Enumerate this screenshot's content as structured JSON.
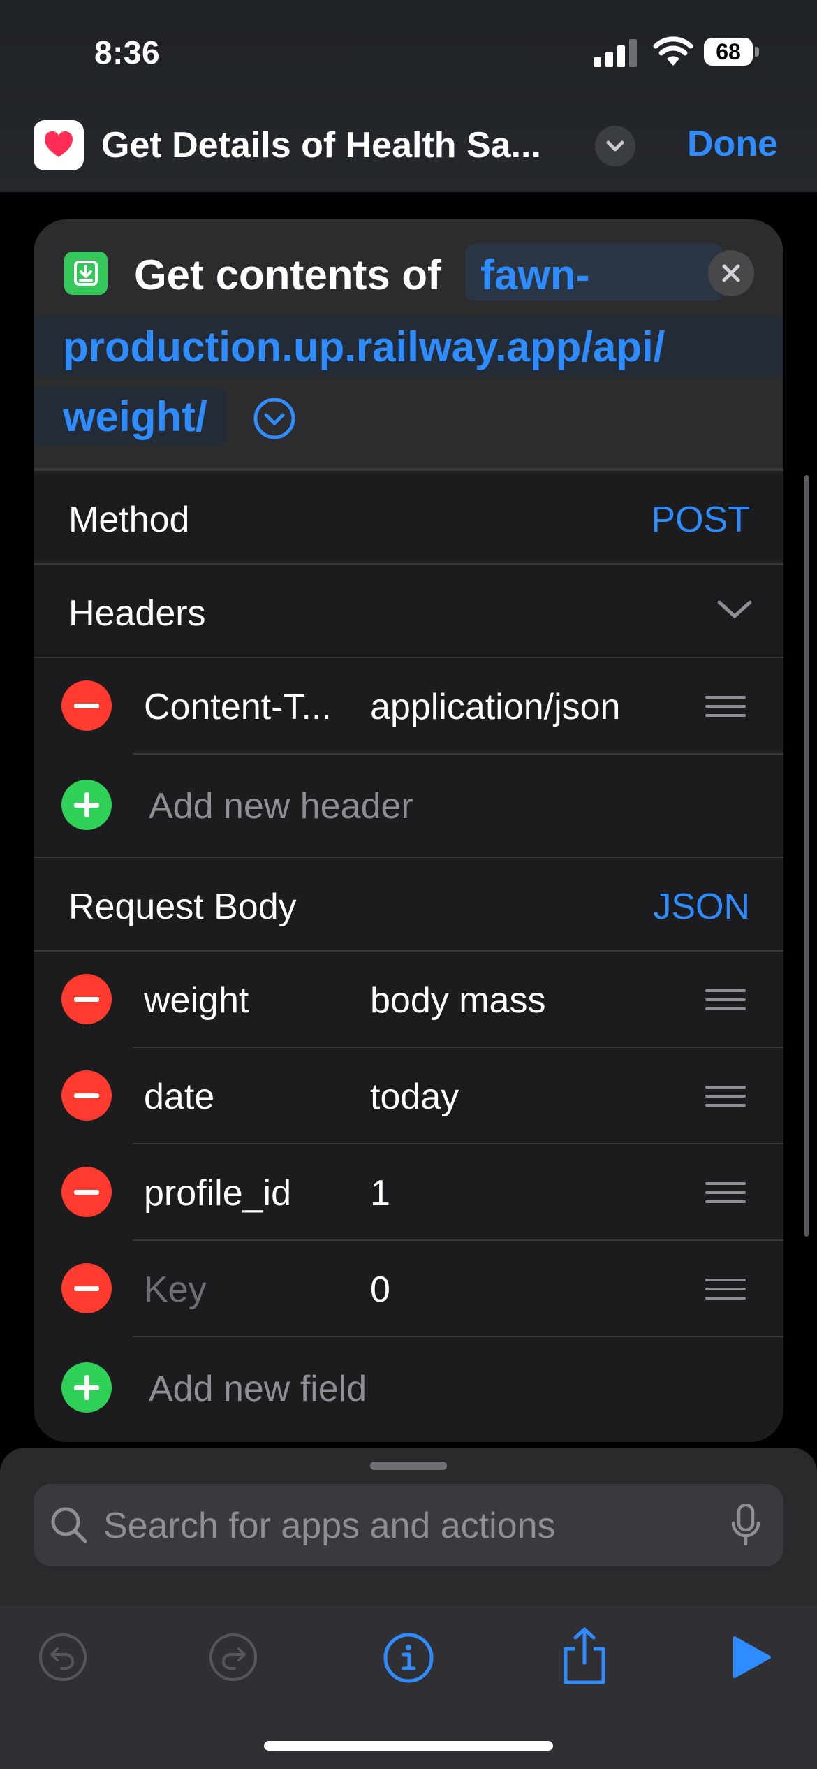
{
  "status": {
    "time": "8:36",
    "battery": "68"
  },
  "nav": {
    "title": "Get Details of Health Sa...",
    "done_label": "Done"
  },
  "action": {
    "prefix": "Get contents of",
    "url_line1": "fawn-",
    "url_line2": "production.up.railway.app/api/",
    "url_line3": "weight/"
  },
  "method": {
    "label": "Method",
    "value": "POST"
  },
  "headers": {
    "label": "Headers",
    "items": [
      {
        "key": "Content-T...",
        "value": "application/json"
      }
    ],
    "add_label": "Add new header"
  },
  "body": {
    "label": "Request Body",
    "type": "JSON",
    "fields": [
      {
        "key": "weight",
        "value": "body mass"
      },
      {
        "key": "date",
        "value": "today"
      },
      {
        "key": "profile_id",
        "value": "1"
      },
      {
        "key": "Key",
        "value": "0"
      }
    ],
    "add_label": "Add new field"
  },
  "search": {
    "placeholder": "Search for apps and actions"
  },
  "icons": [
    "heart-icon",
    "download-icon",
    "close-icon",
    "chevron-down-icon",
    "search-icon",
    "mic-icon",
    "undo-icon",
    "redo-icon",
    "info-icon",
    "share-icon",
    "play-icon"
  ],
  "colors": {
    "accent": "#2f8cff",
    "danger": "#ff3b30",
    "success": "#30d158",
    "card": "#1c1c1e"
  }
}
